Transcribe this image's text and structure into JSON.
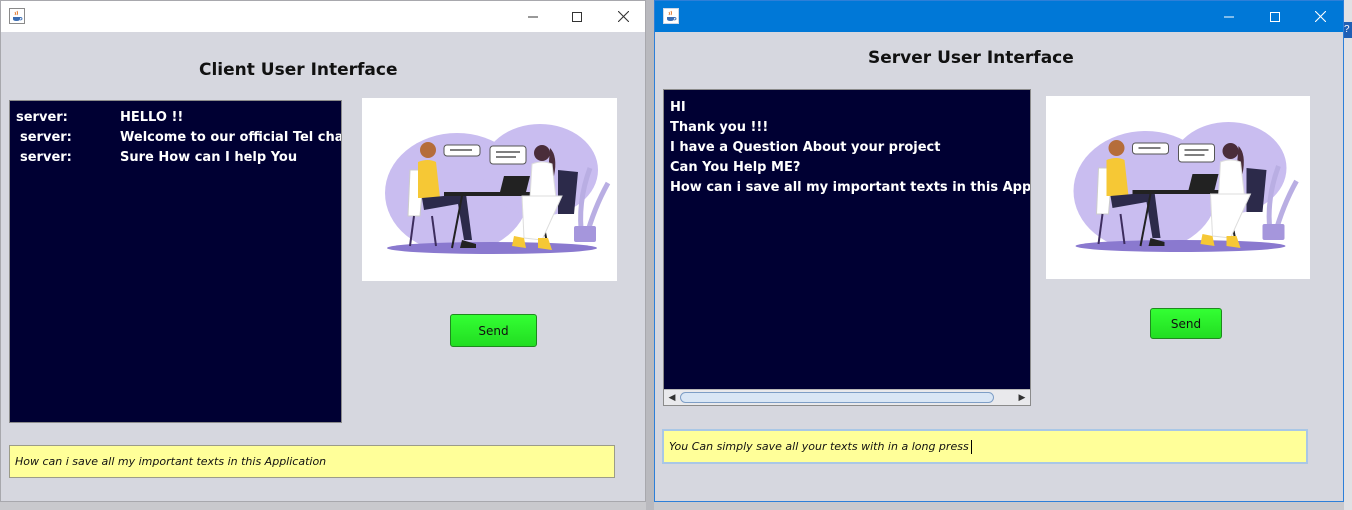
{
  "client": {
    "heading": "Client User Interface",
    "chat": [
      {
        "sender": "server:",
        "text": "HELLO !!"
      },
      {
        "sender": "server:",
        "text": "Welcome to our official Tel chat"
      },
      {
        "sender": "server:",
        "text": "Sure How can I help You"
      }
    ],
    "send_label": "Send",
    "input_value": "How can i save all my important texts in this Application"
  },
  "server": {
    "heading": "Server User Interface",
    "chat": [
      "HI",
      "Thank you !!!",
      "I have a Question About your project",
      "Can You Help ME?",
      "How can i save all my important texts in this Application"
    ],
    "send_label": "Send",
    "input_value": "You Can simply save all your texts with in a long press"
  },
  "help_glyph": "?",
  "icons": {
    "app": "java-cup-icon",
    "minimize": "minimize-icon",
    "maximize": "maximize-icon",
    "close": "close-icon",
    "scroll_left": "scroll-left-icon",
    "scroll_right": "scroll-right-icon"
  },
  "colors": {
    "chat_bg": "#000033",
    "send_green": "#22dd22",
    "input_yellow": "#ffff99",
    "server_titlebar": "#0078d7",
    "illustration_purple": "#c9bdf0"
  }
}
